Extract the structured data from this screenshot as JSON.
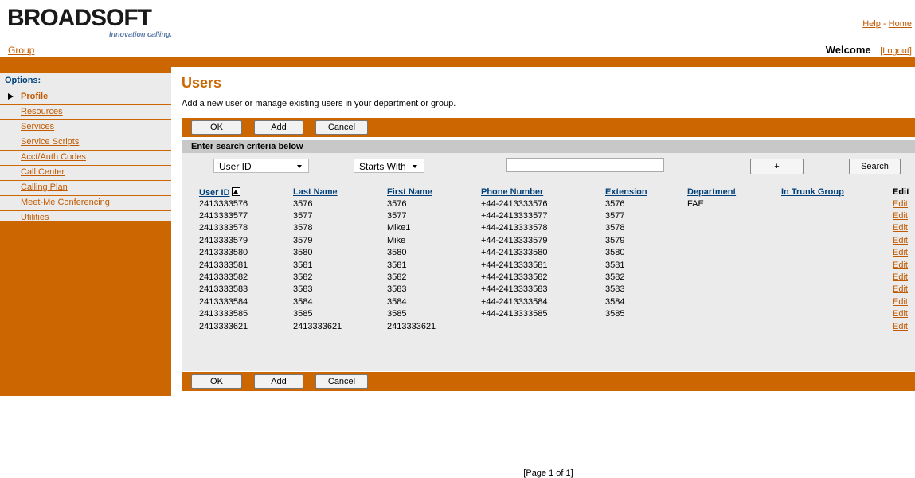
{
  "header": {
    "logo_text": "BROADSOFT",
    "logo_tagline": "Innovation calling.",
    "help_link": "Help",
    "separator": "-",
    "home_link": "Home",
    "group_link": "Group",
    "welcome_text": "Welcome",
    "logout_link": "[Logout]"
  },
  "sidebar": {
    "title": "Options:",
    "items": [
      {
        "label": "Profile",
        "active": true
      },
      {
        "label": "Resources"
      },
      {
        "label": "Services"
      },
      {
        "label": "Service Scripts"
      },
      {
        "label": "Acct/Auth Codes"
      },
      {
        "label": "Call Center"
      },
      {
        "label": "Calling Plan"
      },
      {
        "label": "Meet-Me Conferencing"
      },
      {
        "label": "Utilities"
      }
    ]
  },
  "main": {
    "title": "Users",
    "description": "Add a new user or manage existing users in your department or group.",
    "buttons": {
      "ok": "OK",
      "add": "Add",
      "cancel": "Cancel"
    },
    "search": {
      "heading": "Enter search criteria below",
      "field_select": "User ID",
      "mode_select": "Starts With",
      "input_value": "",
      "plus_button": "+",
      "search_button": "Search"
    },
    "table": {
      "columns": [
        "User ID",
        "Last Name",
        "First Name",
        "Phone Number",
        "Extension",
        "Department",
        "In Trunk Group",
        "Edit"
      ],
      "rows": [
        [
          "2413333576",
          "3576",
          "3576",
          "+44-2413333576",
          "3576",
          "FAE",
          "",
          "Edit"
        ],
        [
          "2413333577",
          "3577",
          "3577",
          "+44-2413333577",
          "3577",
          "",
          "",
          "Edit"
        ],
        [
          "2413333578",
          "3578",
          "Mike1",
          "+44-2413333578",
          "3578",
          "",
          "",
          "Edit"
        ],
        [
          "2413333579",
          "3579",
          "Mike",
          "+44-2413333579",
          "3579",
          "",
          "",
          "Edit"
        ],
        [
          "2413333580",
          "3580",
          "3580",
          "+44-2413333580",
          "3580",
          "",
          "",
          "Edit"
        ],
        [
          "2413333581",
          "3581",
          "3581",
          "+44-2413333581",
          "3581",
          "",
          "",
          "Edit"
        ],
        [
          "2413333582",
          "3582",
          "3582",
          "+44-2413333582",
          "3582",
          "",
          "",
          "Edit"
        ],
        [
          "2413333583",
          "3583",
          "3583",
          "+44-2413333583",
          "3583",
          "",
          "",
          "Edit"
        ],
        [
          "2413333584",
          "3584",
          "3584",
          "+44-2413333584",
          "3584",
          "",
          "",
          "Edit"
        ],
        [
          "2413333585",
          "3585",
          "3585",
          "+44-2413333585",
          "3585",
          "",
          "",
          "Edit"
        ],
        [
          "2413333621",
          "2413333621",
          "2413333621",
          "",
          "",
          "",
          "",
          "Edit"
        ]
      ],
      "pager": "[Page 1 of 1]"
    }
  },
  "colors": {
    "accent": "#cc6600",
    "link": "#c15a00",
    "panel": "#ebebeb",
    "header_link": "#00407a"
  }
}
